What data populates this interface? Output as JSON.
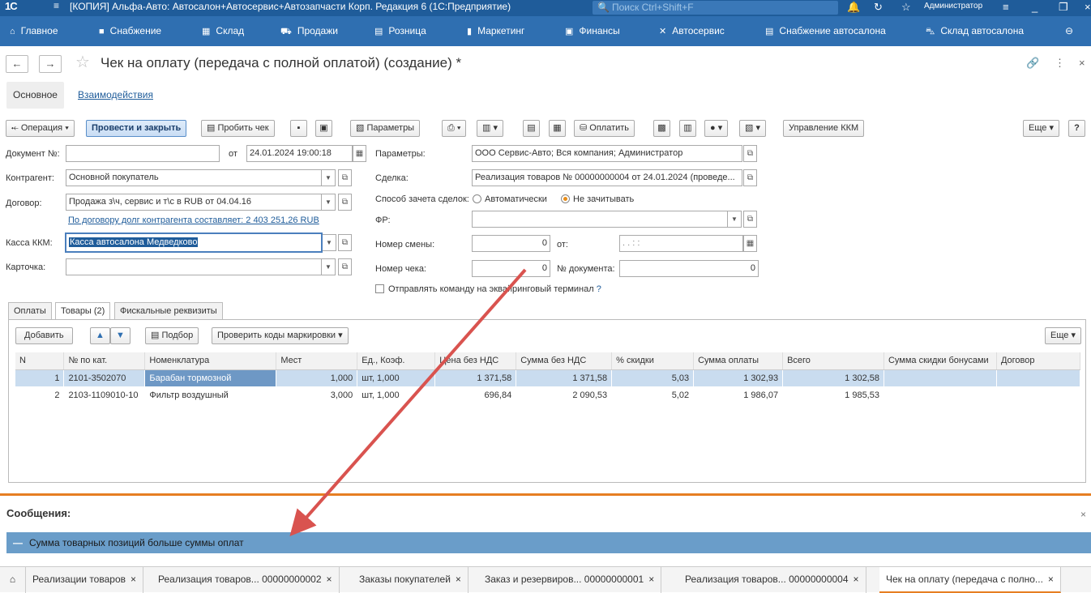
{
  "titlebar": {
    "logo": "1С",
    "title": "[КОПИЯ] Альфа-Авто: Автосалон+Автосервис+Автозапчасти Корп. Редакция 6  (1С:Предприятие)",
    "search_placeholder": "Поиск Ctrl+Shift+F",
    "user": "Администратор"
  },
  "nav": [
    {
      "label": "Главное",
      "icon": "home-icon"
    },
    {
      "label": "Снабжение",
      "icon": "truck-icon"
    },
    {
      "label": "Склад",
      "icon": "warehouse-icon"
    },
    {
      "label": "Продажи",
      "icon": "cart-icon"
    },
    {
      "label": "Розница",
      "icon": "register-icon"
    },
    {
      "label": "Маркетинг",
      "icon": "chart-icon"
    },
    {
      "label": "Финансы",
      "icon": "finance-icon"
    },
    {
      "label": "Автосервис",
      "icon": "tools-icon"
    },
    {
      "label": "Снабжение автосалона",
      "icon": "doc-icon"
    },
    {
      "label": "Склад автосалона",
      "icon": "car-icon"
    }
  ],
  "form": {
    "title": "Чек на оплату (передача с полной оплатой) (создание) *"
  },
  "formtabs": [
    "Основное",
    "Взаимодействия"
  ],
  "toolbar": {
    "operation": "Операция",
    "post_close": "Провести и закрыть",
    "print_check": "Пробить чек",
    "params": "Параметры",
    "pay": "Оплатить",
    "kkm": "Управление ККМ",
    "more": "Еще",
    "help": "?"
  },
  "fields": {
    "doc_no_label": "Документ №:",
    "doc_no": "",
    "from_label": "от",
    "date": "24.01.2024 19:00:18",
    "params_label": "Параметры:",
    "params": "ООО Сервис-Авто; Вся компания; Администратор",
    "counterparty_label": "Контрагент:",
    "counterparty": "Основной покупатель",
    "deal_label": "Сделка:",
    "deal": "Реализация товаров № 00000000004 от 24.01.2024 (проведе...",
    "contract_label": "Договор:",
    "contract": "Продажа з\\ч, сервис и т\\с в RUB от 04.04.16",
    "offset_label": "Способ зачета сделок:",
    "offset_auto": "Автоматически",
    "offset_none": "Не зачитывать",
    "debt_link": "По договору долг контрагента составляет: 2 403 251,26 RUB",
    "fr_label": "ФР:",
    "fr": "",
    "kkm_label": "Касса ККМ:",
    "kkm": "Касса автосалона Медведково",
    "shift_label": "Номер смены:",
    "shift": "0",
    "shift_from_label": "от:",
    "shift_date": " .  .     :  :",
    "card_label": "Карточка:",
    "card": "",
    "check_no_label": "Номер чека:",
    "check_no": "0",
    "docnum_label": "№ документа:",
    "docnum": "0",
    "acquiring_label": "Отправлять команду на эквайринговый терминал",
    "acquiring_help": "?"
  },
  "innertabs": [
    "Оплаты",
    "Товары (2)",
    "Фискальные реквизиты"
  ],
  "tabletoolbar": {
    "add": "Добавить",
    "pick": "Подбор",
    "check_codes": "Проверить коды маркировки",
    "more": "Еще"
  },
  "table": {
    "columns": [
      "N",
      "№ по кат.",
      "Номенклатура",
      "Мест",
      "Ед., Коэф.",
      "Цена без НДС",
      "Сумма без НДС",
      "% скидки",
      "Сумма оплаты",
      "Всего",
      "Сумма скидки бонусами",
      "Договор"
    ],
    "rows": [
      [
        "1",
        "2101-3502070",
        "Барабан тормозной",
        "1,000",
        "шт, 1,000",
        "1 371,58",
        "1 371,58",
        "5,03",
        "1 302,93",
        "1 302,58",
        "",
        ""
      ],
      [
        "2",
        "2103-1109010-10",
        "Фильтр воздушный",
        "3,000",
        "шт, 1,000",
        "696,84",
        "2 090,53",
        "5,02",
        "1 986,07",
        "1 985,53",
        "",
        ""
      ]
    ]
  },
  "messages": {
    "title": "Сообщения:",
    "close": "×",
    "text": "Сумма товарных позиций больше суммы оплат",
    "dash": "—"
  },
  "bottomtabs": [
    "Реализации товаров",
    "Реализация товаров... 00000000002",
    "Заказы покупателей",
    "Заказ и резервиров... 00000000001",
    "Реализация товаров... 00000000004",
    "Чек на оплату (передача с полно..."
  ],
  "colors": {
    "accent": "#2f6fb1",
    "title": "#1f5c9a",
    "orange": "#e67e22",
    "arrow": "#d9534f"
  }
}
